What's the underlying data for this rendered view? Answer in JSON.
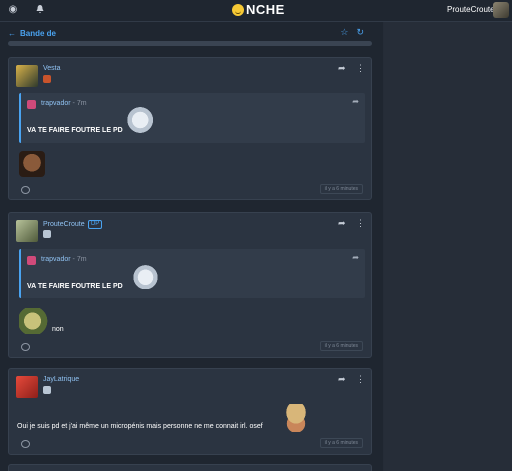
{
  "topbar": {
    "logo": "NCHE",
    "username": "ProuteCroute",
    "icons": [
      "compass-icon",
      "bell-icon",
      "smiley-logo-icon"
    ]
  },
  "subheader": {
    "back_label": "Bande de",
    "icons": [
      "star-icon",
      "refresh-icon"
    ]
  },
  "posts": [
    {
      "author": "Vesta",
      "op": "",
      "quote": {
        "author": "trapvador",
        "time": "7m",
        "text": "VA TE FAIRE FOUTRE LE PD"
      },
      "body": "",
      "time": "il y a 6 minutes"
    },
    {
      "author": "ProuteCroute",
      "op": "OP",
      "quote": {
        "author": "trapvador",
        "time": "7m",
        "text": "VA TE FAIRE FOUTRE LE PD"
      },
      "body": "non",
      "time": "il y a 6 minutes"
    },
    {
      "author": "JayLatrique",
      "op": "",
      "quote": null,
      "body": "Oui je suis pd et j'ai même un micropénis mais personne ne me connait irl. osef",
      "time": "il y a 6 minutes"
    }
  ],
  "colors": {
    "accent": "#4aa3f0",
    "background": "#252c37",
    "card": "#2b3441"
  }
}
